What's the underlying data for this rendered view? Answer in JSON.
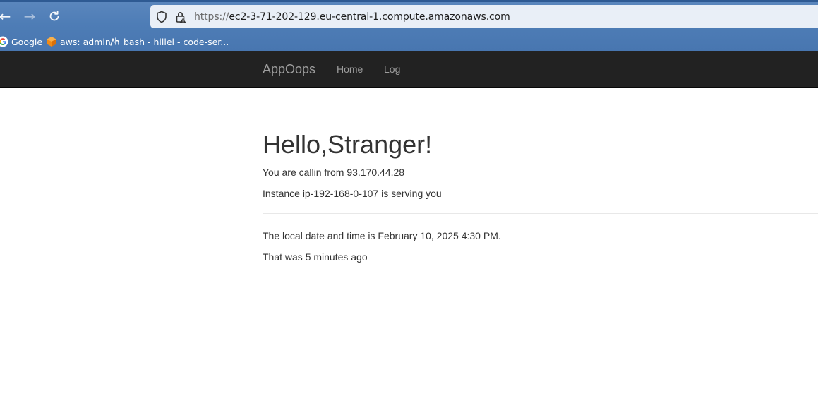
{
  "browser": {
    "url_protocol": "https://",
    "url_host": "ec2-3-71-202-129.eu-central-1.compute.amazonaws.com",
    "nav": {
      "back_icon": "arrow-left-icon",
      "forward_icon": "arrow-right-icon",
      "reload_icon": "reload-icon"
    },
    "bookmarks": [
      {
        "label": "Google",
        "icon": "google-icon"
      },
      {
        "label": "aws: admin",
        "icon": "aws-cube-icon"
      },
      {
        "label": "bash - hillel - code-ser...",
        "icon": "code-server-icon"
      }
    ]
  },
  "navbar": {
    "brand": "AppOops",
    "links": [
      "Home",
      "Log"
    ]
  },
  "main": {
    "heading": "Hello,Stranger!",
    "caller_line": "You are callin from 93.170.44.28",
    "instance_line": "Instance ip-192-168-0-107 is serving you",
    "datetime_line": "The local date and time is February 10, 2025 4:30 PM.",
    "ago_line": "That was 5 minutes ago"
  },
  "colors": {
    "navbar_bg": "#222222",
    "navbar_text": "#9d9d9d",
    "body_text": "#333333",
    "browser_chrome": "#4e7db6"
  }
}
